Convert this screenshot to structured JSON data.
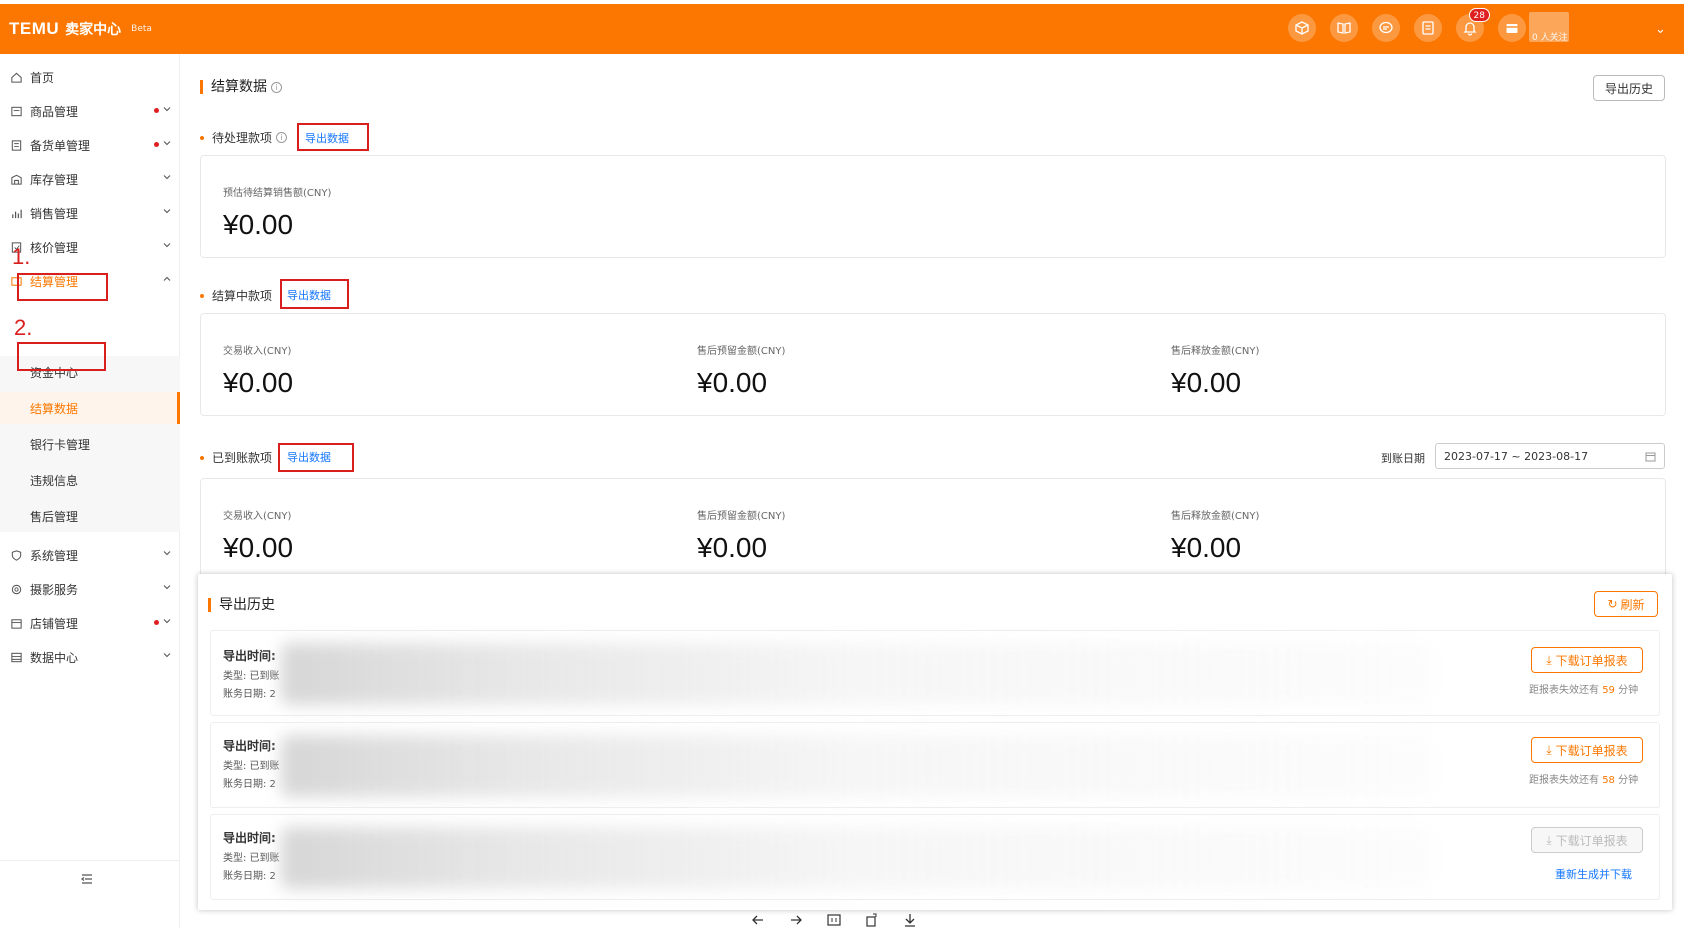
{
  "header": {
    "logo": "TEMU",
    "subtitle": "卖家中心",
    "badge": "Beta",
    "notification_count": "28",
    "account_text": "0 人关注",
    "icons": [
      "cube-icon",
      "book-icon",
      "chat-icon",
      "note-icon",
      "bell-icon",
      "shop-icon"
    ]
  },
  "sidebar": {
    "items": [
      {
        "label": "首页",
        "icon": "home-icon"
      },
      {
        "label": "商品管理",
        "icon": "product-icon",
        "dot": true
      },
      {
        "label": "备货单管理",
        "icon": "order-icon",
        "dot": true
      },
      {
        "label": "库存管理",
        "icon": "warehouse-icon"
      },
      {
        "label": "销售管理",
        "icon": "chart-icon"
      },
      {
        "label": "核价管理",
        "icon": "price-icon"
      },
      {
        "label": "结算管理",
        "icon": "settlement-icon",
        "expanded": true
      },
      {
        "label": "系统管理",
        "icon": "shield-icon"
      },
      {
        "label": "摄影服务",
        "icon": "camera-icon"
      },
      {
        "label": "店铺管理",
        "icon": "store-icon",
        "dot": true
      },
      {
        "label": "数据中心",
        "icon": "data-icon"
      }
    ],
    "sub_items": [
      {
        "label": "资金中心"
      },
      {
        "label": "结算数据",
        "active": true
      },
      {
        "label": "银行卡管理"
      },
      {
        "label": "违规信息"
      },
      {
        "label": "售后管理"
      }
    ]
  },
  "annotations": {
    "step1": "1.",
    "step2": "2."
  },
  "main": {
    "title": "结算数据",
    "export_history_label": "导出历史",
    "export_data_label": "导出数据",
    "pending": {
      "title": "待处理款项",
      "metrics": [
        {
          "label": "预估待结算销售额(CNY)",
          "value": "¥0.00"
        }
      ]
    },
    "settling": {
      "title": "结算中款项",
      "metrics": [
        {
          "label": "交易收入(CNY)",
          "value": "¥0.00"
        },
        {
          "label": "售后预留金额(CNY)",
          "value": "¥0.00"
        },
        {
          "label": "售后释放金额(CNY)",
          "value": "¥0.00"
        }
      ]
    },
    "arrived": {
      "title": "已到账款项",
      "date_label": "到账日期",
      "date_range": "2023-07-17 ~ 2023-08-17",
      "metrics": [
        {
          "label": "交易收入(CNY)",
          "value": "¥0.00"
        },
        {
          "label": "售后预留金额(CNY)",
          "value": "¥0.00"
        },
        {
          "label": "售后释放金额(CNY)",
          "value": "¥0.00"
        }
      ]
    }
  },
  "export_panel": {
    "title": "导出历史",
    "refresh_label": "刷新",
    "rows": [
      {
        "time_label": "导出时间:",
        "type_label": "类型: 已到账",
        "date_label": "账务日期: 2",
        "button": "下载订单报表",
        "expire_prefix": "距报表失效还有",
        "expire_num": "59",
        "expire_suffix": "分钟",
        "disabled": false
      },
      {
        "time_label": "导出时间:",
        "type_label": "类型: 已到账",
        "date_label": "账务日期: 2",
        "button": "下载订单报表",
        "expire_prefix": "距报表失效还有",
        "expire_num": "58",
        "expire_suffix": "分钟",
        "disabled": false
      },
      {
        "time_label": "导出时间:",
        "type_label": "类型: 已到账",
        "date_label": "账务日期: 2",
        "button": "下载订单报表",
        "regen": "重新生成并下载",
        "disabled": true
      }
    ]
  },
  "colors": {
    "brand": "#fb7701",
    "link": "#1677ff",
    "annotation": "#d91e1e"
  }
}
